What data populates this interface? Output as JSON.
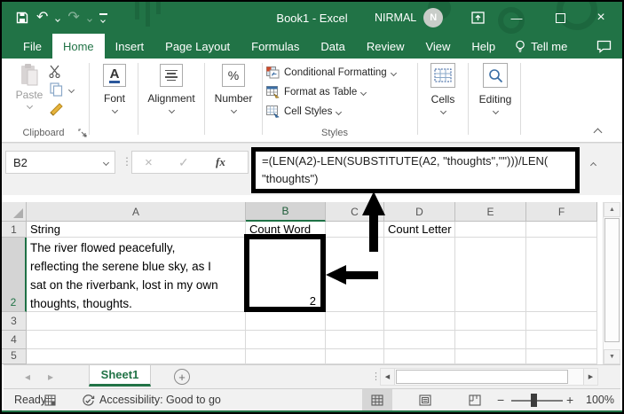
{
  "colors": {
    "accent_green": "#217346",
    "annotation": "#000000"
  },
  "titlebar": {
    "title": "Book1 - Excel",
    "user_name": "NIRMAL",
    "avatar_letter": "N"
  },
  "glyphs": {
    "undo": "↶",
    "redo": "↷",
    "minimize": "—",
    "close": "×",
    "dots_v": "⋮",
    "cancel": "×",
    "enter": "✓",
    "up": "▲",
    "down": "▼",
    "left": "◀",
    "right": "▶",
    "tab_prev": "◂",
    "tab_next": "▸",
    "minus": "−",
    "plus": "+",
    "expand_more": "⋯"
  },
  "tabs": {
    "items": [
      "File",
      "Home",
      "Insert",
      "Page Layout",
      "Formulas",
      "Data",
      "Review",
      "View",
      "Help"
    ],
    "active": "Home",
    "tell_me": "Tell me"
  },
  "ribbon": {
    "paste_label": "Paste",
    "clipboard_group_label": "Clipboard",
    "font_group_label": "Font",
    "font_icon_letter": "A",
    "alignment_group_label": "Alignment",
    "number_group_label": "Number",
    "number_icon_label": "%",
    "conditional_formatting_label": "Conditional Formatting",
    "format_as_table_label": "Format as Table",
    "cell_styles_label": "Cell Styles",
    "styles_group_label": "Styles",
    "cells_group_label": "Cells",
    "editing_group_label": "Editing"
  },
  "formula_bar": {
    "name_box_value": "B2",
    "fx_label": "fx",
    "formula_line1": "=(LEN(A2)-LEN(SUBSTITUTE(A2, \"thoughts\",\"\")))/LEN(",
    "formula_line2": "\"thoughts\")"
  },
  "grid": {
    "column_headers": [
      "A",
      "B",
      "C",
      "D",
      "E",
      "F"
    ],
    "row_headers": [
      "1",
      "2",
      "3",
      "4",
      "5"
    ],
    "cells": {
      "a1": "String",
      "b1": "Count Word",
      "d1": "Count Letter",
      "a2_text": "The river flowed peacefully,\nreflecting the serene blue sky, as I\nsat on the riverbank, lost in my own\nthoughts, thoughts.",
      "b2_value": "2"
    }
  },
  "sheet_bar": {
    "sheet_tab": "Sheet1"
  },
  "status_bar": {
    "mode": "Ready",
    "accessibility": "Accessibility: Good to go",
    "zoom_level": "100%"
  }
}
